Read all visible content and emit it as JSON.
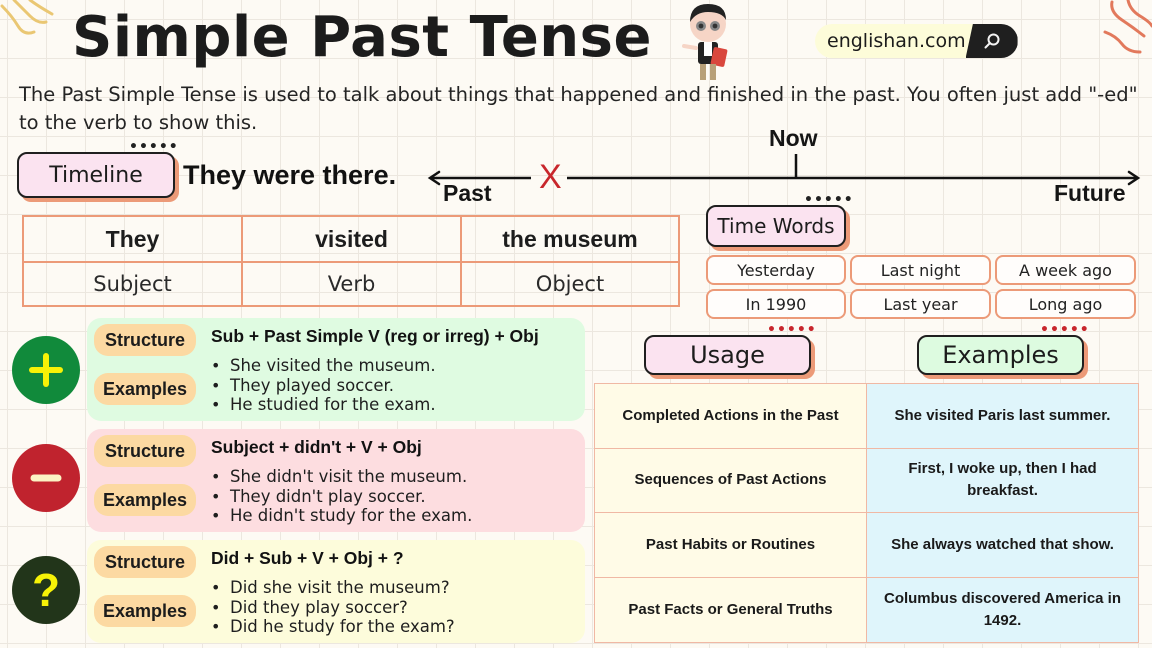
{
  "header": {
    "title": "Simple Past Tense",
    "site": "englishan.com",
    "search_icon": "search-icon",
    "mascot": "cartoon-teacher-illustration"
  },
  "description": "The Past Simple Tense is used to talk about things that happened and finished in the past. You often just add \"-ed\" to the verb to show this.",
  "timeline": {
    "label": "Timeline",
    "sentence": "They were there.",
    "now": "Now",
    "past": "Past",
    "future": "Future",
    "marker": "X"
  },
  "svo_table": {
    "words": [
      "They",
      "visited",
      "the museum"
    ],
    "roles": [
      "Subject",
      "Verb",
      "Object"
    ]
  },
  "time_words": {
    "label": "Time Words",
    "items": [
      "Yesterday",
      "Last night",
      "A week ago",
      "In 1990",
      "Last year",
      "Long ago"
    ]
  },
  "forms": [
    {
      "type": "affirmative",
      "icon": "plus-icon",
      "color": "#118a3b",
      "panel_color": "#dffbe1",
      "structure_label": "Structure",
      "examples_label": "Examples",
      "structure": "Sub + Past Simple V (reg or irreg) + Obj",
      "examples": [
        "She visited the museum.",
        "They played soccer.",
        "He studied for the exam."
      ]
    },
    {
      "type": "negative",
      "icon": "minus-icon",
      "color": "#c0232e",
      "panel_color": "#fddde0",
      "structure_label": "Structure",
      "examples_label": "Examples",
      "structure": "Subject + didn't + V + Obj",
      "examples": [
        "She didn't visit the museum.",
        "They didn't play soccer.",
        "He didn't study for the exam."
      ]
    },
    {
      "type": "interrogative",
      "icon": "question-icon",
      "color": "#22351a",
      "panel_color": "#fdfcdb",
      "structure_label": "Structure",
      "examples_label": "Examples",
      "structure": "Did + Sub + V + Obj + ?",
      "examples": [
        "Did she visit the museum?",
        "Did they play soccer?",
        "Did he study for the exam?"
      ]
    }
  ],
  "usage": {
    "usage_label": "Usage",
    "examples_label": "Examples",
    "rows": [
      {
        "usage": "Completed Actions in the Past",
        "example": "She visited Paris last summer."
      },
      {
        "usage": "Sequences of Past Actions",
        "example": "First, I woke up, then I had breakfast."
      },
      {
        "usage": "Past Habits or Routines",
        "example": "She always watched that show."
      },
      {
        "usage": "Past Facts or General Truths",
        "example": "Columbus discovered America in 1492."
      }
    ]
  },
  "colors": {
    "accent": "#ec9a78",
    "marker": "#c8262c",
    "background": "#fdfaf4"
  }
}
